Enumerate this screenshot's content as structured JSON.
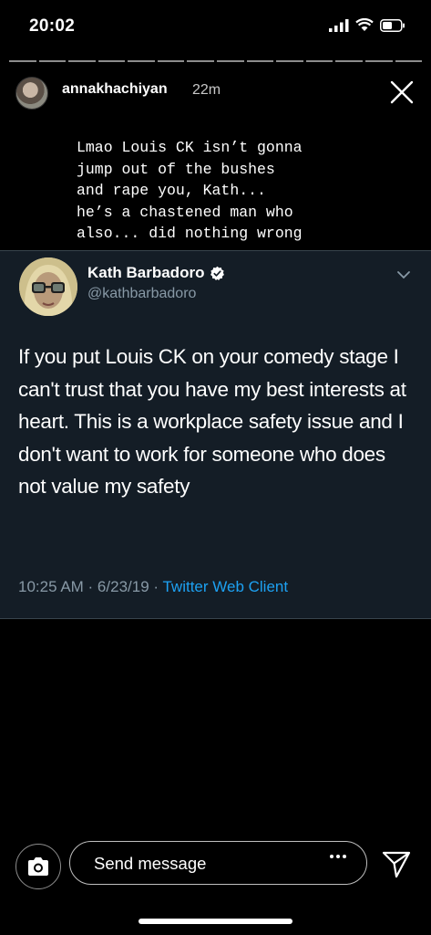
{
  "status_bar": {
    "time": "20:02"
  },
  "story": {
    "segment_count": 14,
    "username": "annakhachiyan",
    "time_ago": "22m",
    "caption": "Lmao Louis CK isn’t gonna\njump out of the bushes\nand rape you, Kath...\nhe’s a chastened man who\nalso... did nothing wrong"
  },
  "tweet": {
    "display_name": "Kath Barbadoro",
    "handle": "@kathbarbadoro",
    "text": "If you put Louis CK on your comedy stage I can't trust that you have my best interests at heart. This is a workplace safety issue and I don't want to work for someone who does not value my safety",
    "timestamp": "10:25 AM · 6/23/19 · ",
    "source": "Twitter Web Client",
    "card_bg": "#141d26",
    "accent": "#1da1f2"
  },
  "reply_bar": {
    "placeholder": "Send message"
  }
}
